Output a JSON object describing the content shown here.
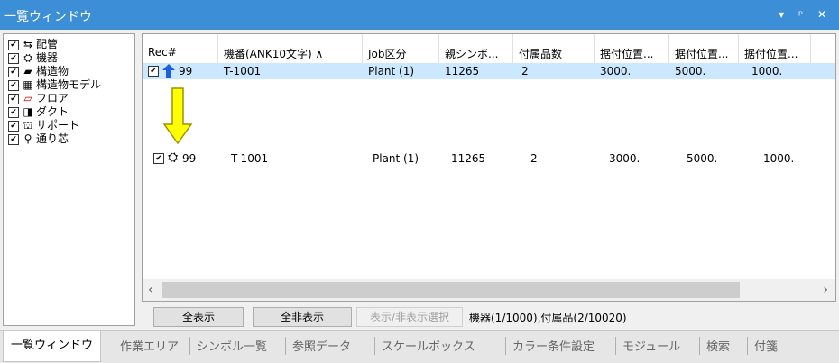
{
  "window": {
    "title": "一覧ウィンドウ",
    "controls": [
      "▾",
      "ᵖ",
      "✕"
    ]
  },
  "tree": [
    {
      "label": "配管",
      "icon": "pipe-icon",
      "glyph": "⇆"
    },
    {
      "label": "機器",
      "icon": "equipment-icon",
      "glyph": "⛭"
    },
    {
      "label": "構造物",
      "icon": "structure-icon",
      "glyph": "▰"
    },
    {
      "label": "構造物モデル",
      "icon": "structure-model-icon",
      "glyph": "▦"
    },
    {
      "label": "フロア",
      "icon": "floor-icon",
      "glyph": "▱"
    },
    {
      "label": "ダクト",
      "icon": "duct-icon",
      "glyph": "◨"
    },
    {
      "label": "サポート",
      "icon": "support-icon",
      "glyph": "⛫"
    },
    {
      "label": "通り芯",
      "icon": "gridline-icon",
      "glyph": "⚲"
    }
  ],
  "table": {
    "columns": [
      "Rec#",
      "機番(ANK10文字) ∧",
      "Job区分",
      "親シンボ...",
      "付属品数",
      "据付位置...",
      "据付位置...",
      "据付位置..."
    ],
    "rows": [
      {
        "rec": "99",
        "id": "T-1001",
        "job": "Plant (1)",
        "parent": "11265",
        "count": "2",
        "x": "3000.",
        "y": "5000.",
        "z": "1000."
      },
      {
        "rec": "99",
        "id": "T-1001",
        "job": "Plant (1)",
        "parent": "11265",
        "count": "2",
        "x": "3000.",
        "y": "5000.",
        "z": "1000."
      }
    ]
  },
  "buttons": {
    "show_all": "全表示",
    "hide_all": "全非表示",
    "toggle_select": "表示/非表示選択"
  },
  "status": "機器(1/1000),付属品(2/10020)",
  "tabs": [
    "一覧ウィンドウ",
    "作業エリア",
    "シンボル一覧",
    "参照データ",
    "スケールボックス",
    "カラー条件設定",
    "モジュール",
    "検索",
    "付箋"
  ],
  "colors": {
    "titlebar": "#3c8fd6",
    "selected_row": "#cce8ff",
    "up_arrow": "#1a5fe0",
    "callout_arrow": "#ffff00"
  }
}
